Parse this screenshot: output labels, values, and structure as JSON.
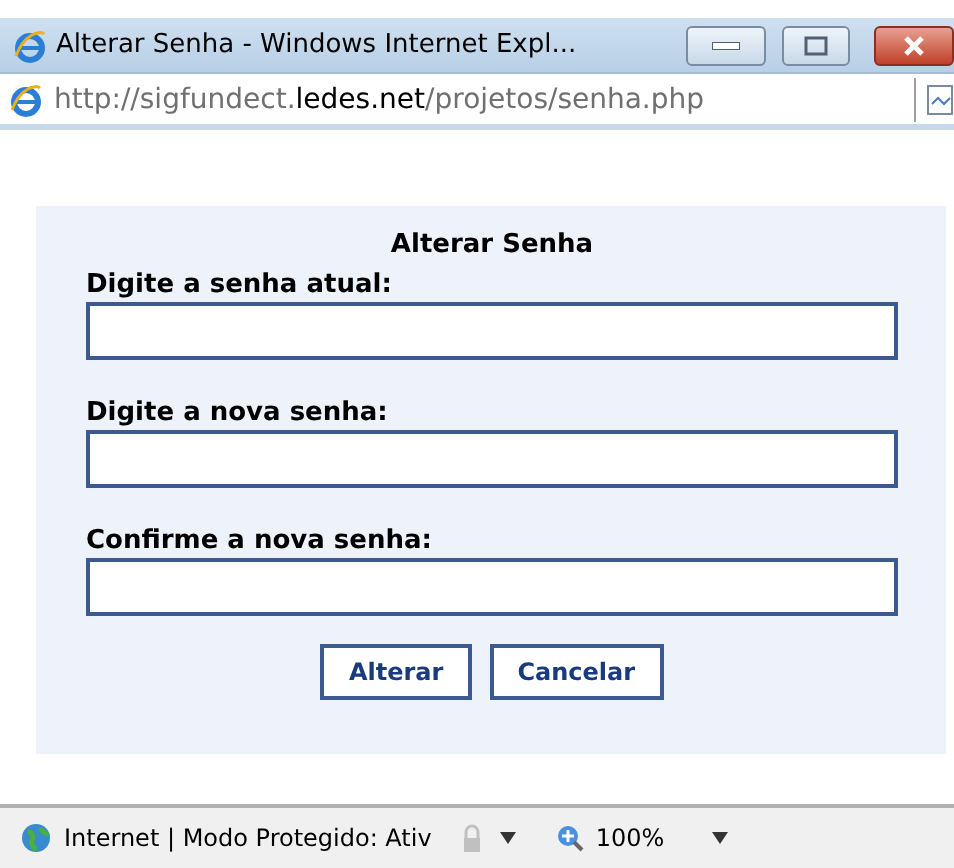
{
  "window": {
    "title": "Alterar Senha - Windows Internet Expl..."
  },
  "address_bar": {
    "url": "http://sigfundect.**ledes.net**/projetos/senha.php"
  },
  "form": {
    "title": "Alterar Senha",
    "fields": [
      {
        "label": "Digite a senha atual:"
      },
      {
        "label": "Digite a nova senha:"
      },
      {
        "label": "Confirme a nova senha:"
      }
    ],
    "buttons": [
      "Alterar",
      "Cancelar"
    ]
  },
  "status_bar": {
    "zone": "Internet | Modo Protegido: Ativ",
    "zoom": "100%"
  }
}
